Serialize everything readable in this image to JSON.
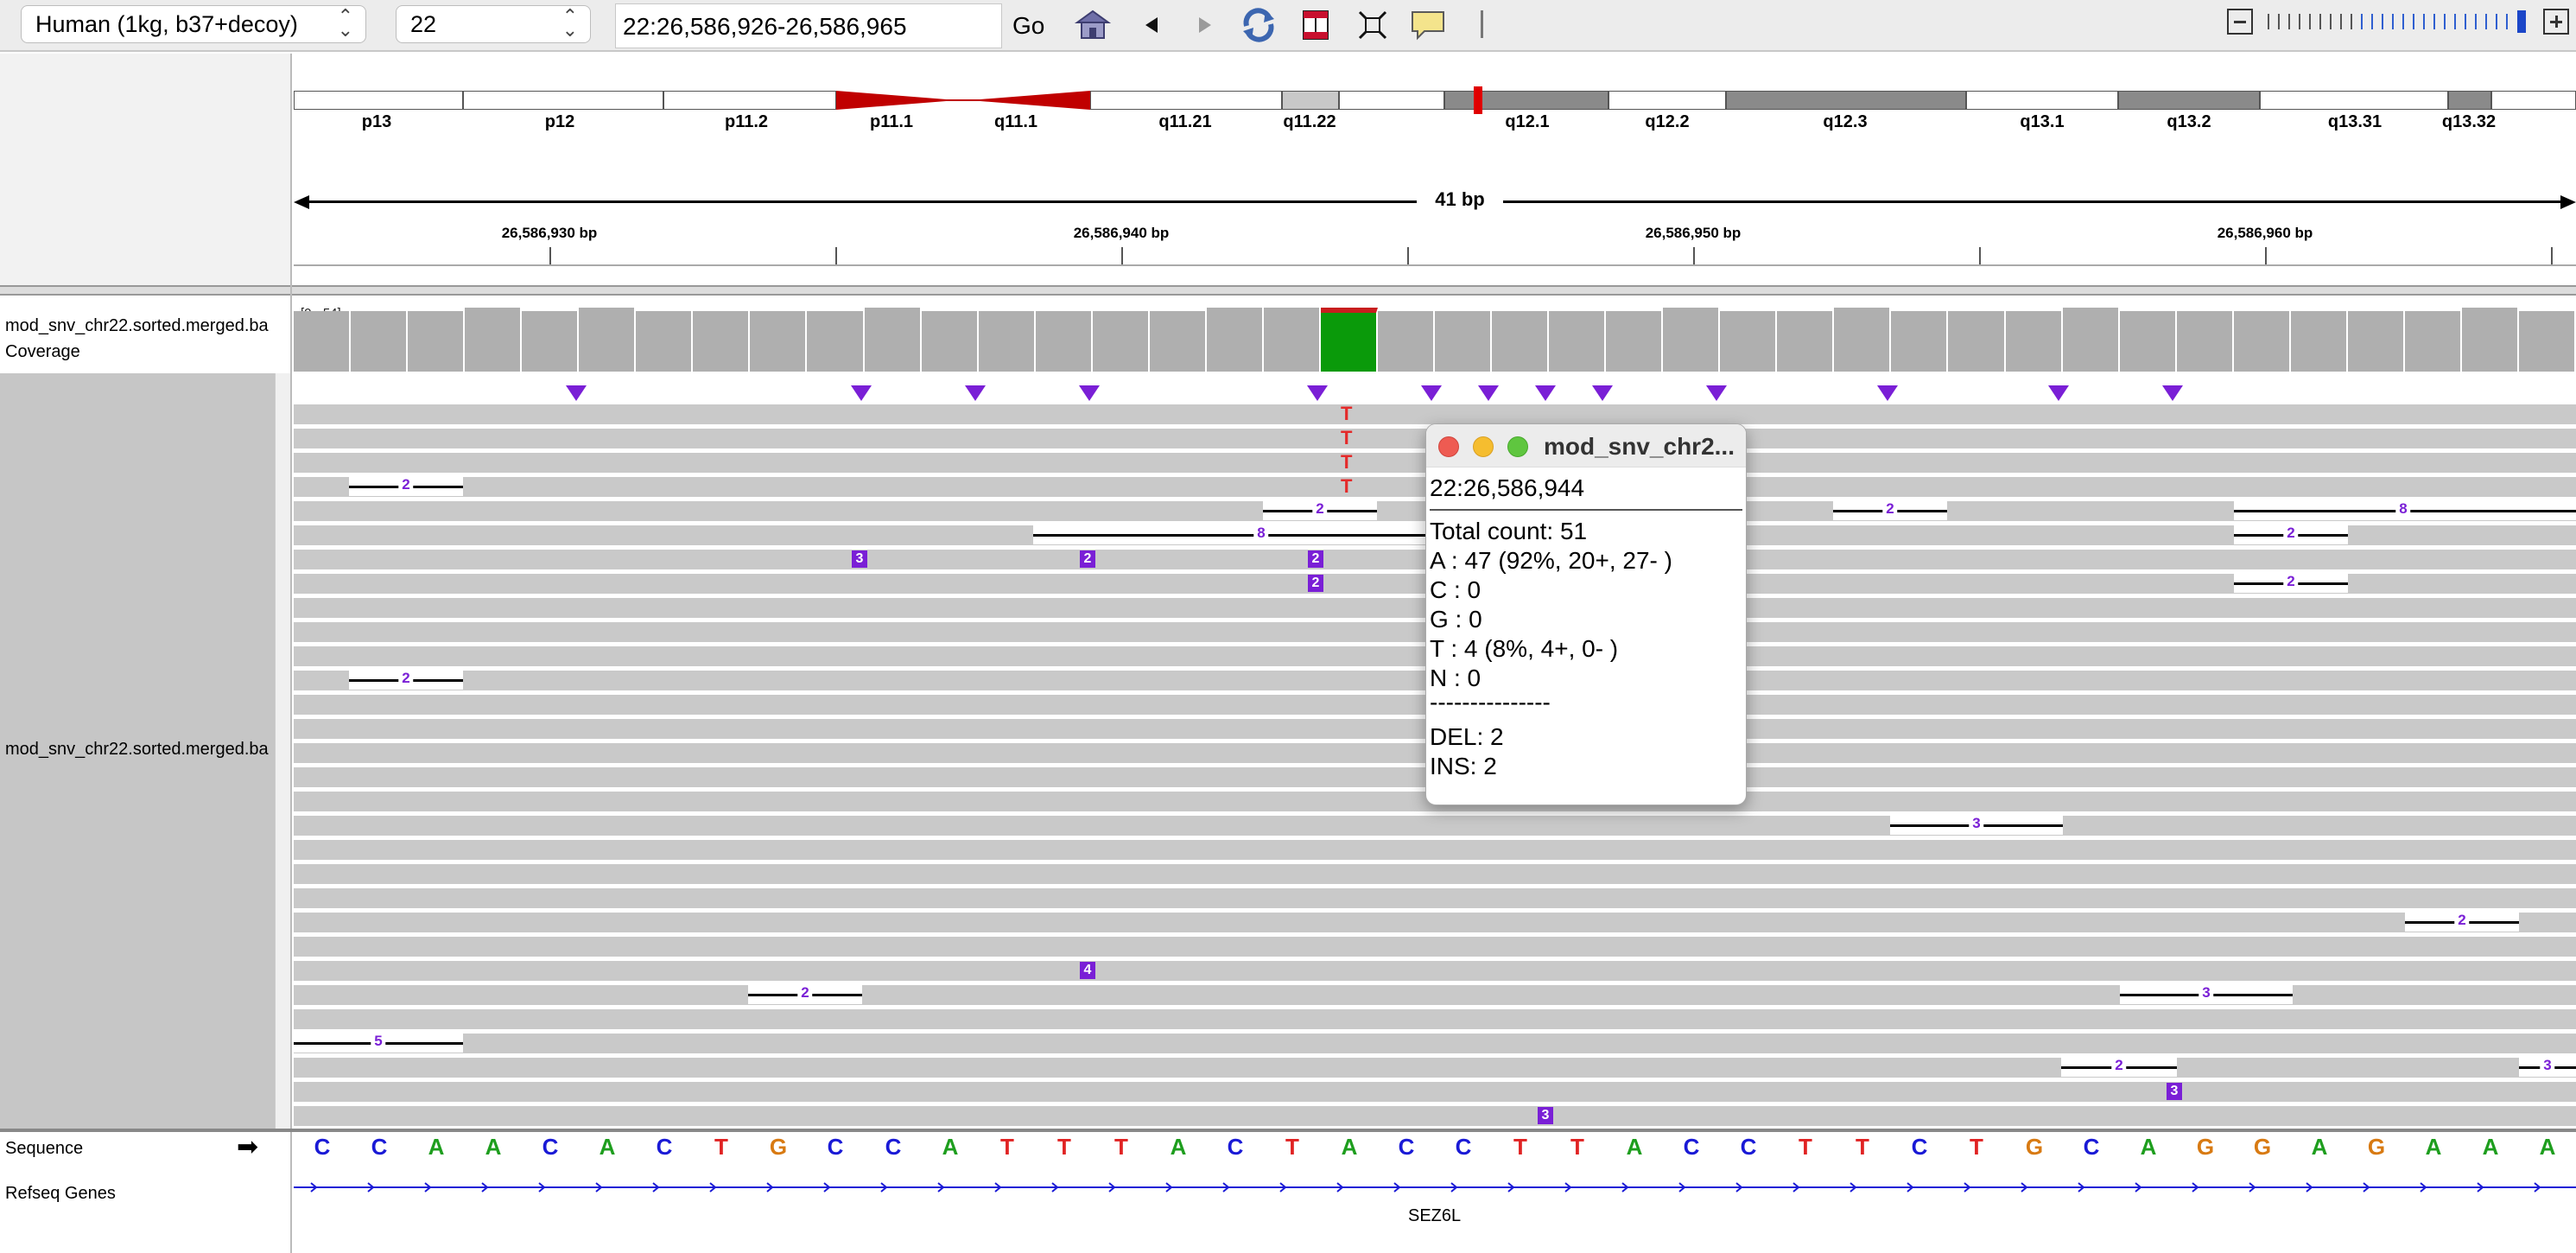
{
  "toolbar": {
    "genome": "Human (1kg, b37+decoy)",
    "chromosome": "22",
    "locus": "22:26,586,926-26,586,965",
    "go_label": "Go"
  },
  "ideogram": {
    "bands": [
      "p13",
      "p12",
      "p11.2",
      "p11.1",
      "q11.1",
      "q11.21",
      "q11.22",
      "q12.1",
      "q12.2",
      "q12.3",
      "q13.1",
      "q13.2",
      "q13.31",
      "q13.32"
    ]
  },
  "ruler": {
    "span_label": "41 bp",
    "tick_labels": [
      "26,586,930 bp",
      "26,586,940 bp",
      "26,586,950 bp",
      "26,586,960 bp"
    ]
  },
  "tracks": {
    "coverage_name": "mod_snv_chr22.sorted.merged.ba",
    "coverage_sub": "Coverage",
    "coverage_range": "[0 - 54]",
    "alignment_name": "mod_snv_chr22.sorted.merged.ba",
    "sequence_name": "Sequence",
    "sequence_arrow": "➡",
    "genes_name": "Refseq Genes",
    "gene_label": "SEZ6L"
  },
  "reads": {
    "mismatch_base": "T",
    "insertion_labels": [
      "3",
      "2",
      "2",
      "2",
      "4",
      "3",
      "3"
    ],
    "deletion_labels": [
      "2",
      "2",
      "8",
      "2",
      "8",
      "2",
      "2",
      "2",
      "3",
      "2",
      "2",
      "3",
      "5",
      "2",
      "3"
    ]
  },
  "sequence": [
    "C",
    "C",
    "A",
    "A",
    "C",
    "A",
    "C",
    "T",
    "G",
    "C",
    "C",
    "A",
    "T",
    "T",
    "T",
    "A",
    "C",
    "T",
    "A",
    "C",
    "C",
    "T",
    "T",
    "A",
    "C",
    "C",
    "T",
    "T",
    "C",
    "T",
    "G",
    "C",
    "A",
    "G",
    "G",
    "A",
    "G",
    "A",
    "A",
    "A"
  ],
  "base_colors": {
    "A": "#1e9e1e",
    "C": "#1a1ad6",
    "G": "#d87a12",
    "T": "#e02222"
  },
  "popup": {
    "title": "mod_snv_chr2...",
    "position": "22:26,586,944",
    "total": "Total count: 51",
    "a": "A : 47 (92%, 20+, 27- )",
    "c": "C : 0",
    "g": "G : 0",
    "t": "T : 4 (8%, 4+, 0- )",
    "n": "N : 0",
    "separator": "---------------",
    "del": "DEL: 2",
    "ins": "INS: 2"
  },
  "colors": {
    "coverage_grey": "#afafaf",
    "read_grey": "#c9c9c9",
    "insertion_purple": "#7a1fd6",
    "coverage_green": "#0a9a0a",
    "ideogram_centromere": "#c00000",
    "gene_blue": "#1a1ad6"
  }
}
